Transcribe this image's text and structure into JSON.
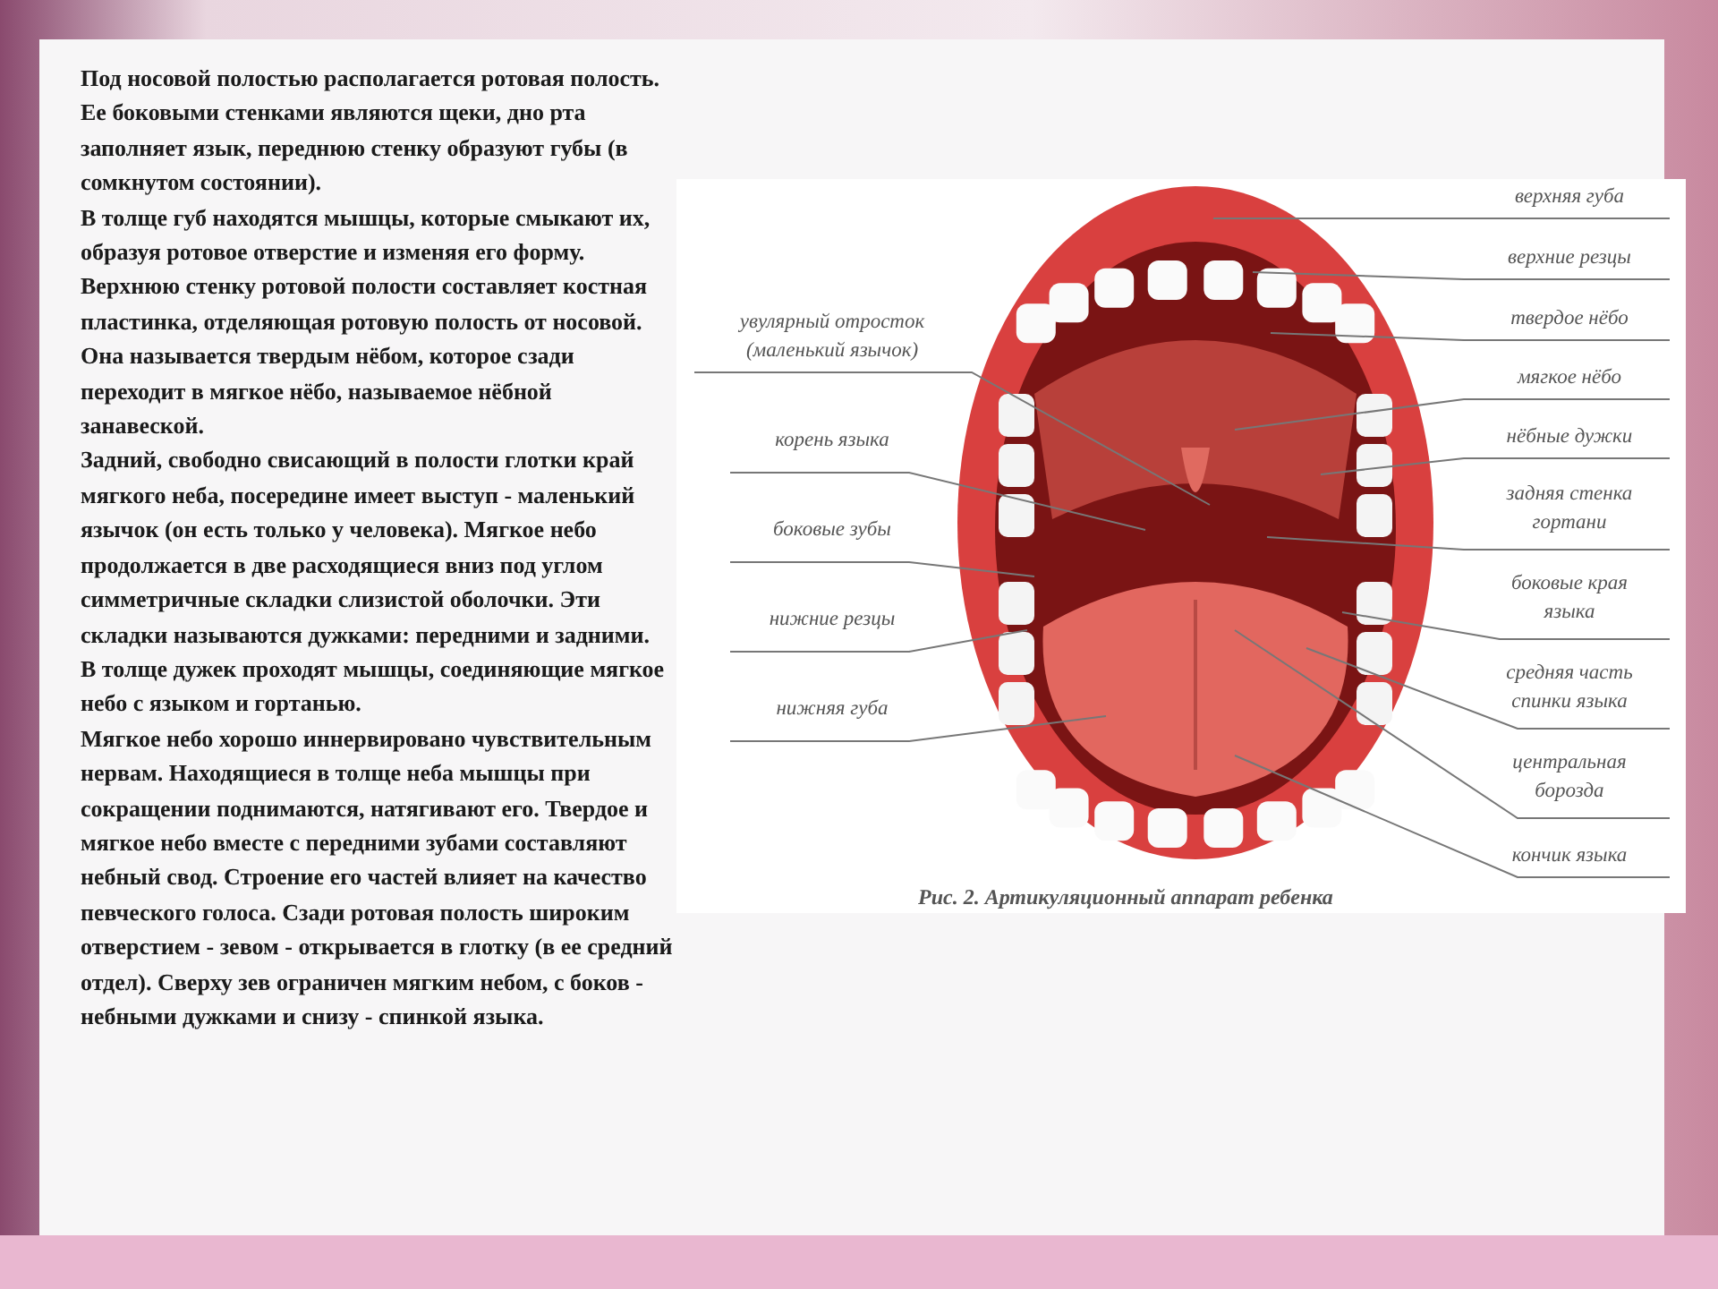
{
  "text": {
    "paragraphs": [
      "Под носовой полостью располагается ротовая полость. Ее боковыми стенками являются щеки, дно рта заполняет язык, переднюю стенку образуют губы (в сомкнутом состоянии).",
      "В толще губ находятся мышцы, которые смыкают их, образуя ротовое отверстие и изменяя его форму.",
      "Верхнюю стенку ротовой полости составляет костная пластинка, отделяющая ротовую полость от носовой. Она называется твердым нёбом, которое сзади переходит в мягкое нёбо, называемое нёбной занавеской.",
      "Задний, свободно свисающий в полости глотки край мягкого неба, посередине имеет выступ - маленький язычок (он есть только у человека). Мягкое небо продолжается в две расходящиеся вниз под углом симметричные складки слизистой оболочки. Эти складки называются дужками: передними и задними.",
      "В толще дужек проходят мышцы, соединяющие мягкое небо с языком и гортанью.",
      "Мягкое небо хорошо иннервировано чувствительным нервам. Находящиеся в толще неба мышцы при сокращении поднимаются, натягивают его. Твердое и мягкое небо вместе с передними зубами составляют небный свод. Строение его частей влияет на качество певческого голоса. Сзади ротовая полость широким отверстием - зевом - открывается в глотку (в ее средний отдел). Сверху зев ограничен мягким небом, с боков - небными дужками и снизу - спинкой языка."
    ]
  },
  "figure": {
    "labels_left": [
      {
        "lines": [
          "увулярный отросток",
          "(маленький язычок)"
        ]
      },
      {
        "lines": [
          "корень языка"
        ]
      },
      {
        "lines": [
          "боковые зубы"
        ]
      },
      {
        "lines": [
          "нижние резцы"
        ]
      },
      {
        "lines": [
          "нижняя губа"
        ]
      }
    ],
    "labels_right": [
      {
        "lines": [
          "верхняя губа"
        ]
      },
      {
        "lines": [
          "верхние резцы"
        ]
      },
      {
        "lines": [
          "твердое нёбо"
        ]
      },
      {
        "lines": [
          "мягкое нёбо"
        ]
      },
      {
        "lines": [
          "нёбные дужки"
        ]
      },
      {
        "lines": [
          "задняя стенка",
          "гортани"
        ]
      },
      {
        "lines": [
          "боковые края",
          "языка"
        ]
      },
      {
        "lines": [
          "средняя часть",
          "спинки языка"
        ]
      },
      {
        "lines": [
          "центральная",
          "борозда"
        ]
      },
      {
        "lines": [
          "кончик языка"
        ]
      }
    ],
    "caption": "Рис. 2. Артикуляционный аппарат ребенка"
  }
}
